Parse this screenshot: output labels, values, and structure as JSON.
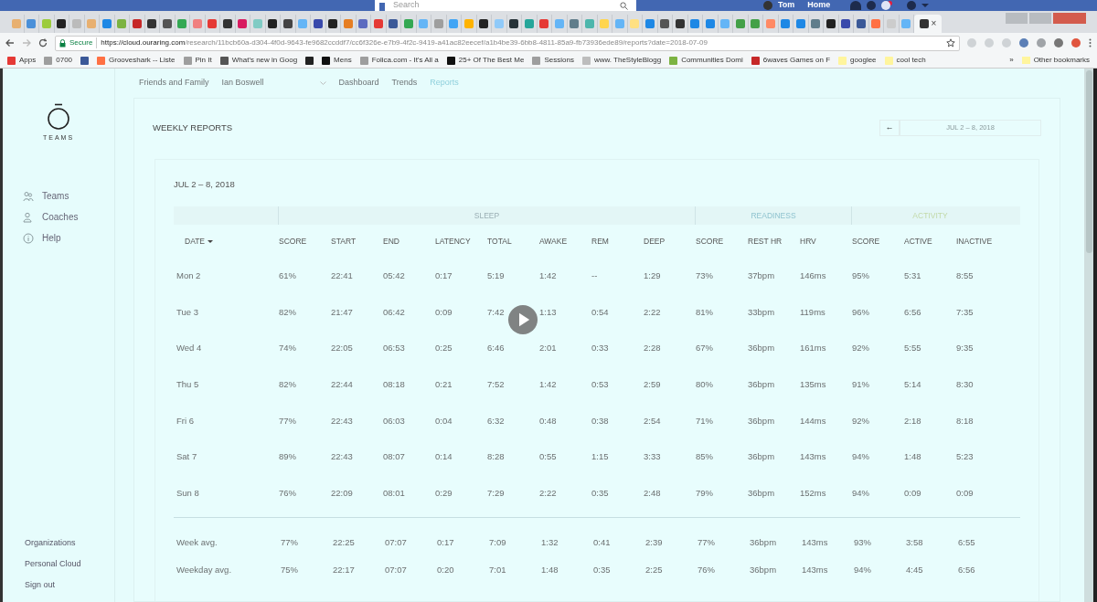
{
  "facebook_bar": {
    "search": {
      "placeholder": "Search"
    },
    "user": "Tom",
    "home": "Home"
  },
  "browser": {
    "tabs": [
      {
        "color": "#e8b070",
        "selected": false
      },
      {
        "color": "#4a90d9",
        "selected": false
      },
      {
        "color": "#9ccc3c",
        "selected": false
      },
      {
        "color": "#222222",
        "selected": false
      },
      {
        "color": "#bbbbbb",
        "selected": false
      },
      {
        "color": "#e8b070",
        "selected": false
      },
      {
        "color": "#1e88e5",
        "selected": false
      },
      {
        "color": "#7cb342",
        "selected": false
      },
      {
        "color": "#c62828",
        "selected": false
      },
      {
        "color": "#333333",
        "selected": false
      },
      {
        "color": "#555555",
        "selected": false
      },
      {
        "color": "#34a853",
        "selected": false
      },
      {
        "color": "#f08080",
        "selected": false
      },
      {
        "color": "#e53935",
        "selected": false
      },
      {
        "color": "#333333",
        "selected": false
      },
      {
        "color": "#d81b60",
        "selected": false
      },
      {
        "color": "#80cbc4",
        "selected": false
      },
      {
        "color": "#222222",
        "selected": false
      },
      {
        "color": "#444444",
        "selected": false
      },
      {
        "color": "#64b5f6",
        "selected": false
      },
      {
        "color": "#3949ab",
        "selected": false
      },
      {
        "color": "#222222",
        "selected": false
      },
      {
        "color": "#e67e22",
        "selected": false
      },
      {
        "color": "#5c6bc0",
        "selected": false
      },
      {
        "color": "#e53935",
        "selected": false
      },
      {
        "color": "#3b5998",
        "selected": false
      },
      {
        "color": "#34a853",
        "selected": false
      },
      {
        "color": "#64b5f6",
        "selected": false
      },
      {
        "color": "#9e9e9e",
        "selected": false
      },
      {
        "color": "#42a5f5",
        "selected": false
      },
      {
        "color": "#ffb300",
        "selected": false
      },
      {
        "color": "#222222",
        "selected": false
      },
      {
        "color": "#90caf9",
        "selected": false
      },
      {
        "color": "#263238",
        "selected": false
      },
      {
        "color": "#26a69a",
        "selected": false
      },
      {
        "color": "#e53935",
        "selected": false
      },
      {
        "color": "#64b5f6",
        "selected": false
      },
      {
        "color": "#607d8b",
        "selected": false
      },
      {
        "color": "#4db6ac",
        "selected": false
      },
      {
        "color": "#ffd54f",
        "selected": false
      },
      {
        "color": "#64b5f6",
        "selected": false
      },
      {
        "color": "#ffe082",
        "selected": false
      },
      {
        "color": "#1e88e5",
        "selected": false
      },
      {
        "color": "#555555",
        "selected": false
      },
      {
        "color": "#333333",
        "selected": false
      },
      {
        "color": "#1e88e5",
        "selected": false
      },
      {
        "color": "#1e88e5",
        "selected": false
      },
      {
        "color": "#64b5f6",
        "selected": false
      },
      {
        "color": "#43a047",
        "selected": false
      },
      {
        "color": "#43a047",
        "selected": false
      },
      {
        "color": "#ff8a65",
        "selected": false
      },
      {
        "color": "#1e88e5",
        "selected": false
      },
      {
        "color": "#1e88e5",
        "selected": false
      },
      {
        "color": "#607d8b",
        "selected": false
      },
      {
        "color": "#222222",
        "selected": false
      },
      {
        "color": "#3949ab",
        "selected": false
      },
      {
        "color": "#3b5998",
        "selected": false
      },
      {
        "color": "#ff7043",
        "selected": false
      },
      {
        "color": "#cccccc",
        "selected": false
      },
      {
        "color": "#64b5f6",
        "selected": false
      },
      {
        "color": "#333333",
        "selected": true
      }
    ],
    "tab_close": "×",
    "secure_label": "Secure",
    "url_host": "https://cloud.ouraring.com",
    "url_path": "/research/11bcb60a-d304-4f0d-9643-fe9682ccddf7/cc6f326e-e7b9-4f2c-9419-a41ac82eecef/a1b4be39-6bb8-4811-85a9-fb73936ede89/reports?date=2018-07-09",
    "bookmarks": [
      {
        "label": "Apps",
        "color": "#e53935"
      },
      {
        "label": "0700",
        "color": "#9e9e9e"
      },
      {
        "color": "#3b5998"
      },
      {
        "label": "Grooveshark -- Liste",
        "color": "#ff7043"
      },
      {
        "label": "Pin It",
        "color": "#9e9e9e"
      },
      {
        "label": "What's new in Goog",
        "color": "#555555"
      },
      {
        "color": "#222222"
      },
      {
        "label": "Mens",
        "color": "#111111"
      },
      {
        "label": "Folica.com - It's All a",
        "color": "#9e9e9e"
      },
      {
        "label": "25+ Of The Best Me",
        "color": "#111111"
      },
      {
        "label": "Sessions",
        "color": "#9e9e9e"
      },
      {
        "label": "www. TheStyleBlogg",
        "color": "#bdbdbd"
      },
      {
        "label": "Communities Domi",
        "color": "#7cb342"
      },
      {
        "label": "6waves Games on F",
        "color": "#c62828"
      },
      {
        "label": "googlee",
        "color": "#fff59d"
      },
      {
        "label": "cool tech",
        "color": "#fff59d"
      }
    ],
    "more": "»",
    "other_bookmarks": "Other bookmarks"
  },
  "nav": {
    "items": [
      {
        "label": "Friends and Family",
        "selected": false
      },
      {
        "label": "Ian Boswell",
        "selected": false
      },
      {
        "label": "Dashboard",
        "selected": false
      },
      {
        "label": "Trends",
        "selected": false
      },
      {
        "label": "Reports",
        "selected": true
      }
    ]
  },
  "sidebar": {
    "logo": "TEAMS",
    "items": [
      {
        "label": "Teams",
        "kind": "teams"
      },
      {
        "label": "Coaches",
        "kind": "coaches"
      },
      {
        "label": "Help",
        "kind": "help"
      }
    ],
    "footer": [
      "Organizations",
      "Personal Cloud",
      "Sign out"
    ]
  },
  "reports": {
    "title": "WEEKLY REPORTS",
    "back": "←",
    "range_field": "JUL 2 – 8, 2018",
    "week": "JUL 2 – 8, 2018",
    "groups": [
      {
        "label": "SLEEP",
        "color": "#9aaeb4"
      },
      {
        "label": "READINESS",
        "color": "#8fc3cf"
      },
      {
        "label": "ACTIVITY",
        "color": "#c2d9a8"
      }
    ],
    "columns": [
      "DATE",
      "SCORE",
      "START",
      "END",
      "LATENCY",
      "TOTAL",
      "AWAKE",
      "REM",
      "DEEP",
      "SCORE",
      "REST HR",
      "HRV",
      "SCORE",
      "ACTIVE",
      "INACTIVE"
    ],
    "rows": [
      [
        "Mon 2",
        "61%",
        "22:41",
        "05:42",
        "0:17",
        "5:19",
        "1:42",
        "--",
        "1:29",
        "73%",
        "37bpm",
        "146ms",
        "95%",
        "5:31",
        "8:55"
      ],
      [
        "Tue 3",
        "82%",
        "21:47",
        "06:42",
        "0:09",
        "7:42",
        "1:13",
        "0:54",
        "2:22",
        "81%",
        "33bpm",
        "119ms",
        "96%",
        "6:56",
        "7:35"
      ],
      [
        "Wed 4",
        "74%",
        "22:05",
        "06:53",
        "0:25",
        "6:46",
        "2:01",
        "0:33",
        "2:28",
        "67%",
        "36bpm",
        "161ms",
        "92%",
        "5:55",
        "9:35"
      ],
      [
        "Thu 5",
        "82%",
        "22:44",
        "08:18",
        "0:21",
        "7:52",
        "1:42",
        "0:53",
        "2:59",
        "80%",
        "36bpm",
        "135ms",
        "91%",
        "5:14",
        "8:30"
      ],
      [
        "Fri 6",
        "77%",
        "22:43",
        "06:03",
        "0:04",
        "6:32",
        "0:48",
        "0:38",
        "2:54",
        "71%",
        "36bpm",
        "144ms",
        "92%",
        "2:18",
        "8:18"
      ],
      [
        "Sat 7",
        "89%",
        "22:43",
        "08:07",
        "0:14",
        "8:28",
        "0:55",
        "1:15",
        "3:33",
        "85%",
        "36bpm",
        "143ms",
        "94%",
        "1:48",
        "5:23"
      ],
      [
        "Sun 8",
        "76%",
        "22:09",
        "08:01",
        "0:29",
        "7:29",
        "2:22",
        "0:35",
        "2:48",
        "79%",
        "36bpm",
        "152ms",
        "94%",
        "0:09",
        "0:09"
      ]
    ],
    "averages": [
      [
        "Week avg.",
        "77%",
        "22:25",
        "07:07",
        "0:17",
        "7:09",
        "1:32",
        "0:41",
        "2:39",
        "77%",
        "36bpm",
        "143ms",
        "93%",
        "3:58",
        "6:55"
      ],
      [
        "Weekday avg.",
        "75%",
        "22:17",
        "07:07",
        "0:20",
        "7:01",
        "1:48",
        "0:35",
        "2:25",
        "76%",
        "36bpm",
        "143ms",
        "94%",
        "4:45",
        "6:56"
      ]
    ]
  }
}
